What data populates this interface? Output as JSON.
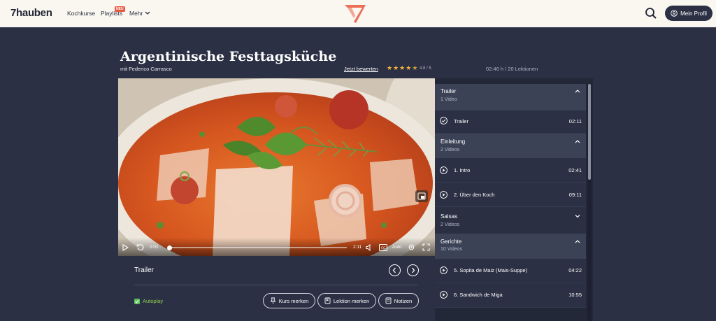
{
  "header": {
    "logo": "7hauben",
    "nav": {
      "kochkurse": "Kochkurse",
      "playlists": "Playlists",
      "mehr": "Mehr"
    },
    "badge": "NEU",
    "profile_label": "Mein Profil"
  },
  "course": {
    "title": "Argentinische Festtagsküche",
    "author": "mit Federico Carrasco",
    "rate_link": "Jetzt bewerten",
    "rating": "4.8 / 5",
    "rating_value": 4.8,
    "duration": "02:46 h / 20 Lektionen"
  },
  "player": {
    "current_time": "0:01",
    "total_time": "2:11",
    "quality": "Auto",
    "progress": 0.01
  },
  "below": {
    "lesson_title": "Trailer",
    "autoplay_label": "Autoplay",
    "buttons": {
      "kurs": "Kurs merken",
      "lektion": "Lektion merken",
      "notizen": "Notizen"
    }
  },
  "sidebar": {
    "sections": [
      {
        "title": "Trailer",
        "count": "1 Video",
        "expanded": true,
        "lessons": [
          {
            "name": "Trailer",
            "time": "02:11",
            "state": "done"
          }
        ]
      },
      {
        "title": "Einleitung",
        "count": "2 Videos",
        "expanded": true,
        "lessons": [
          {
            "name": "1. Intro",
            "time": "02:41",
            "state": "play"
          },
          {
            "name": "2. Über den Koch",
            "time": "09:11",
            "state": "play"
          }
        ]
      },
      {
        "title": "Salsas",
        "count": "2 Videos",
        "expanded": false,
        "lessons": []
      },
      {
        "title": "Gerichte",
        "count": "10 Videos",
        "expanded": true,
        "lessons": [
          {
            "name": "5. Sopita de Maiz (Mais-Suppe)",
            "time": "04:22",
            "state": "play"
          },
          {
            "name": "6. Sandwich de Miga",
            "time": "10:55",
            "state": "play"
          }
        ]
      }
    ]
  },
  "colors": {
    "page_bg": "#2b3044",
    "header_bg": "#faf7f0",
    "accent": "#e9573f",
    "star": "#f2b33d",
    "autoplay": "#8fd14f"
  }
}
